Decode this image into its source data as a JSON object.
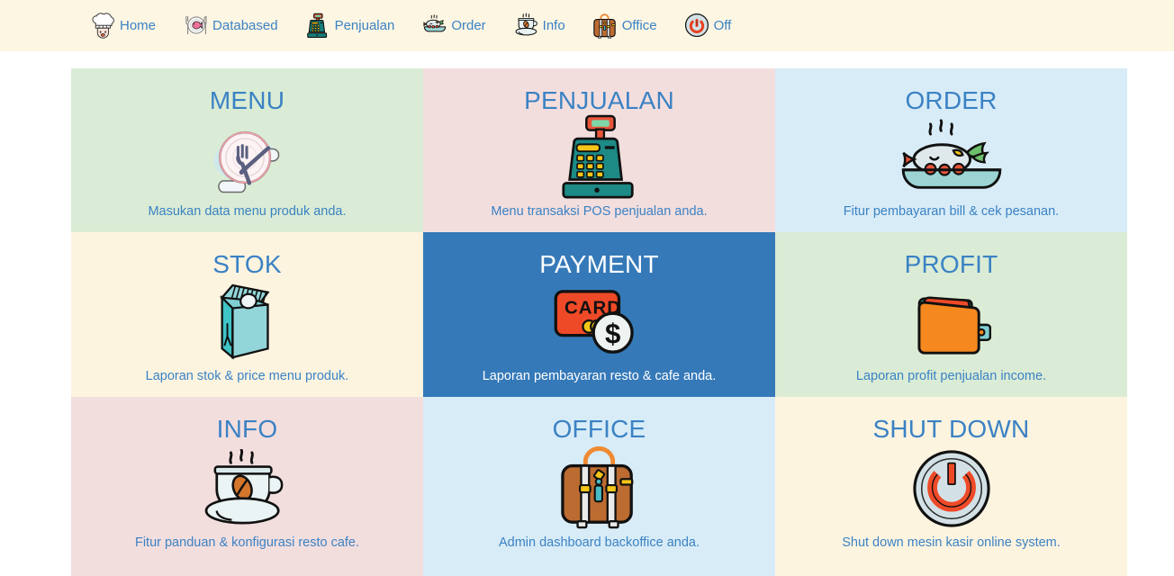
{
  "nav": {
    "items": [
      {
        "label": "Home",
        "icon": "chef-hat-icon"
      },
      {
        "label": "Databased",
        "icon": "plate-fish-cutlery-icon"
      },
      {
        "label": "Penjualan",
        "icon": "cash-register-icon"
      },
      {
        "label": "Order",
        "icon": "fish-plate-icon"
      },
      {
        "label": "Info",
        "icon": "coffee-cup-icon"
      },
      {
        "label": "Office",
        "icon": "briefcase-icon"
      },
      {
        "label": "Off",
        "icon": "power-button-icon"
      }
    ],
    "background_color": "#fdf6e3",
    "label_color": "#3b82c4"
  },
  "tiles": [
    {
      "title": "MENU",
      "desc": "Masukan data menu produk anda.",
      "icon": "plate-fork-knife-icon",
      "bg": "#daecd5",
      "active": false
    },
    {
      "title": "PENJUALAN",
      "desc": "Menu transaksi POS penjualan anda.",
      "icon": "cash-register-icon",
      "bg": "#f3dede",
      "active": false
    },
    {
      "title": "ORDER",
      "desc": "Fitur pembayaran bill & cek pesanan.",
      "icon": "fish-dish-icon",
      "bg": "#d8ecf7",
      "active": false
    },
    {
      "title": "STOK",
      "desc": "Laporan stok & price menu produk.",
      "icon": "milk-carton-icon",
      "bg": "#fdf4e0",
      "active": false
    },
    {
      "title": "PAYMENT",
      "desc": "Laporan pembayaran resto & cafe anda.",
      "icon": "credit-card-coin-icon",
      "bg": "#3579b8",
      "active": true
    },
    {
      "title": "PROFIT",
      "desc": "Laporan profit penjualan income.",
      "icon": "wallet-icon",
      "bg": "#daecd5",
      "active": false
    },
    {
      "title": "INFO",
      "desc": "Fitur panduan & konfigurasi resto cafe.",
      "icon": "coffee-cup-icon",
      "bg": "#f3dede",
      "active": false
    },
    {
      "title": "OFFICE",
      "desc": "Admin dashboard backoffice anda.",
      "icon": "briefcase-icon",
      "bg": "#d8ecf7",
      "active": false
    },
    {
      "title": "SHUT DOWN",
      "desc": "Shut down mesin kasir online system.",
      "icon": "power-button-icon",
      "bg": "#fdf4e0",
      "active": false
    }
  ],
  "colors": {
    "accent_blue": "#3b82c4",
    "active_tile": "#3579b8",
    "header_cream": "#fdf6e3",
    "page_background": "#ffffff"
  }
}
